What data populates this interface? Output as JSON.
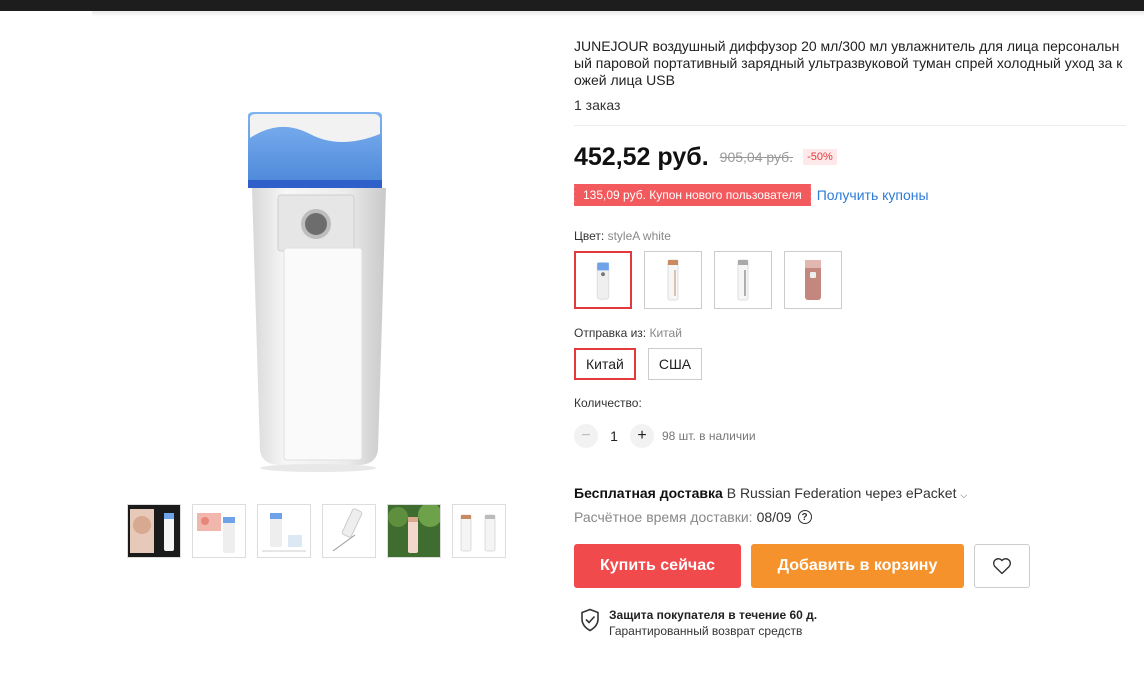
{
  "product": {
    "title": "JUNEJOUR воздушный диффузор 20 мл/300 мл увлажнитель для лица персональный паровой портативный зарядный ультразвуковой туман спрей холодный уход за кожей лица USB",
    "orders": "1 заказ"
  },
  "pricing": {
    "price": "452,52 руб.",
    "old_price": "905,04 руб.",
    "discount": "-50%",
    "coupon": "135,09 руб. Купон нового пользователя",
    "coupon_link": "Получить купоны"
  },
  "color": {
    "label": "Цвет:",
    "selected": "styleA white"
  },
  "shipping_from": {
    "label": "Отправка из:",
    "selected": "Китай",
    "options": [
      "Китай",
      "США"
    ]
  },
  "quantity": {
    "label": "Количество:",
    "value": "1",
    "stock": "98 шт. в наличии"
  },
  "delivery": {
    "free_label": "Бесплатная доставка",
    "details": "В Russian Federation через ePacket",
    "eta_label": "Расчётное время доставки:",
    "eta_date": "08/09"
  },
  "buttons": {
    "buy_now": "Купить сейчас",
    "add_to_cart": "Добавить в корзину"
  },
  "protection": {
    "title": "Защита покупателя в течение 60 д.",
    "subtitle": "Гарантированный возврат средств"
  },
  "icons": {
    "wishlist": "heart-icon",
    "protection": "shield-check-icon",
    "help": "question-icon"
  },
  "colors": {
    "accent_red": "#f04a4c",
    "accent_orange": "#f6922b",
    "link_blue": "#2e7bd9"
  }
}
